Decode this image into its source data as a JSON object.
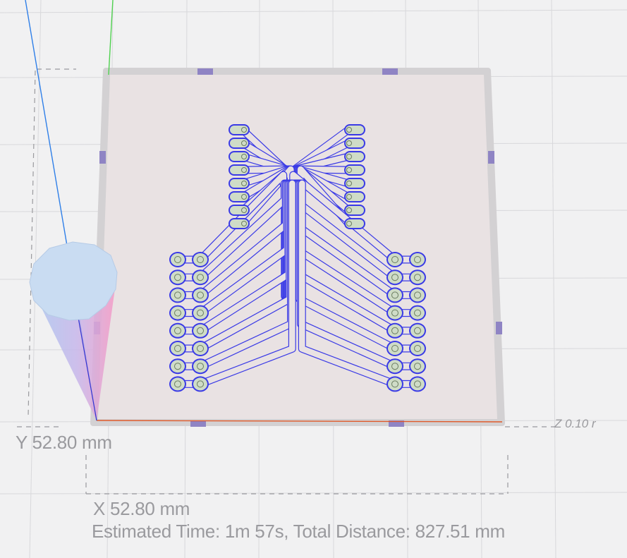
{
  "viewport": {
    "y_dimension": "Y 52.80 mm",
    "x_dimension": "X 52.80 mm",
    "estimate": "Estimated Time: 1m 57s, Total Distance: 827.51 mm",
    "z_label": "Z 0.10 r"
  },
  "colors": {
    "background": "#f1f1f2",
    "grid": "#d8d8db",
    "workpiece_fill": "#e9e2e3",
    "workpiece_frame": "#d3d1d3",
    "clamp": "#8f84c4",
    "toolpath": "#3a3ae6",
    "pad": "#cfdcc7",
    "x_axis": "#e05a2a",
    "y_axis": "#4fd14f",
    "z_axis": "#2f7fe8",
    "tool": "#bcd6f0"
  },
  "icons": [
    "cutting-tool-cone-icon",
    "clamp-tab-icon"
  ]
}
